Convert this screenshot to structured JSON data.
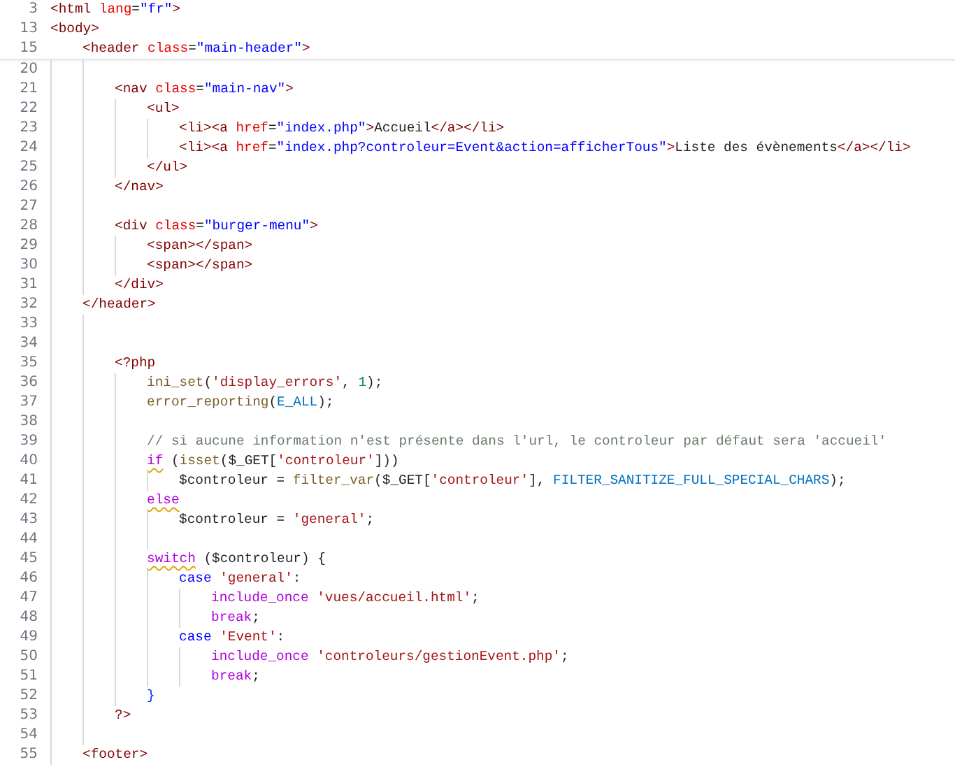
{
  "editor": {
    "sticky_lines": [
      {
        "number": "3",
        "tokens": [
          {
            "text": "<html",
            "kind": "tag"
          },
          {
            "text": " lang",
            "kind": "attr"
          },
          {
            "text": "=",
            "kind": "punct"
          },
          {
            "text": "\"fr\"",
            "kind": "astr"
          },
          {
            "text": ">",
            "kind": "tag"
          }
        ]
      },
      {
        "number": "13",
        "tokens": [
          {
            "text": "<body>",
            "kind": "tag"
          }
        ],
        "children": [
          {
            "number": "15",
            "tokens": [
              {
                "text": "<header",
                "kind": "tag"
              },
              {
                "text": " class",
                "kind": "attr"
              },
              {
                "text": "=",
                "kind": "punct"
              },
              {
                "text": "\"main-header\"",
                "kind": "astr"
              },
              {
                "text": ">",
                "kind": "tag"
              }
            ]
          }
        ]
      }
    ],
    "lines": [
      {
        "children": [
          {
            "number": "20"
          },
          {
            "number": "21",
            "tokens": [
              {
                "text": "<nav",
                "kind": "tag"
              },
              {
                "text": " class",
                "kind": "attr"
              },
              {
                "text": "=",
                "kind": "punct"
              },
              {
                "text": "\"main-nav\"",
                "kind": "astr"
              },
              {
                "text": ">",
                "kind": "tag"
              }
            ],
            "children": [
              {
                "number": "22",
                "tokens": [
                  {
                    "text": "<ul>",
                    "kind": "tag"
                  }
                ],
                "children": [
                  {
                    "number": "23",
                    "tokens": [
                      {
                        "text": "<li><a",
                        "kind": "tag"
                      },
                      {
                        "text": " href",
                        "kind": "attr"
                      },
                      {
                        "text": "=",
                        "kind": "punct"
                      },
                      {
                        "text": "\"index.php\"",
                        "kind": "astr"
                      },
                      {
                        "text": ">",
                        "kind": "tag"
                      },
                      {
                        "text": "Accueil",
                        "kind": "text"
                      },
                      {
                        "text": "</a></li>",
                        "kind": "tag"
                      }
                    ]
                  },
                  {
                    "number": "24",
                    "tokens": [
                      {
                        "text": "<li><a",
                        "kind": "tag"
                      },
                      {
                        "text": " href",
                        "kind": "attr"
                      },
                      {
                        "text": "=",
                        "kind": "punct"
                      },
                      {
                        "text": "\"index.php?controleur=Event&action=afficherTous\"",
                        "kind": "astr"
                      },
                      {
                        "text": ">",
                        "kind": "tag"
                      },
                      {
                        "text": "Liste des évènements",
                        "kind": "text"
                      },
                      {
                        "text": "</a></li>",
                        "kind": "tag"
                      }
                    ]
                  }
                ]
              },
              {
                "number": "25",
                "tokens": [
                  {
                    "text": "</ul>",
                    "kind": "tag"
                  }
                ]
              }
            ]
          },
          {
            "number": "26",
            "tokens": [
              {
                "text": "</nav>",
                "kind": "tag"
              }
            ]
          },
          {
            "number": "27"
          },
          {
            "number": "28",
            "tokens": [
              {
                "text": "<div",
                "kind": "tag"
              },
              {
                "text": " class",
                "kind": "attr"
              },
              {
                "text": "=",
                "kind": "punct"
              },
              {
                "text": "\"burger-menu\"",
                "kind": "astr"
              },
              {
                "text": ">",
                "kind": "tag"
              }
            ],
            "children": [
              {
                "number": "29",
                "tokens": [
                  {
                    "text": "<span></span>",
                    "kind": "tag"
                  }
                ]
              },
              {
                "number": "30",
                "tokens": [
                  {
                    "text": "<span></span>",
                    "kind": "tag"
                  }
                ]
              }
            ]
          },
          {
            "number": "31",
            "tokens": [
              {
                "text": "</div>",
                "kind": "tag"
              }
            ]
          }
        ]
      },
      {
        "number": "32",
        "tokens": [
          {
            "text": "</header>",
            "kind": "tag"
          }
        ]
      },
      {
        "children": [
          {
            "number": "33"
          },
          {
            "number": "34"
          },
          {
            "number": "35",
            "tokens": [
              {
                "text": "<?php",
                "kind": "php"
              }
            ],
            "children": [
              {
                "number": "36",
                "tokens": [
                  {
                    "text": "ini_set",
                    "kind": "fn"
                  },
                  {
                    "text": "(",
                    "kind": "punct"
                  },
                  {
                    "text": "'display_errors'",
                    "kind": "pstr"
                  },
                  {
                    "text": ", ",
                    "kind": "punct"
                  },
                  {
                    "text": "1",
                    "kind": "num"
                  },
                  {
                    "text": ");",
                    "kind": "punct"
                  }
                ]
              },
              {
                "number": "37",
                "tokens": [
                  {
                    "text": "error_reporting",
                    "kind": "fn"
                  },
                  {
                    "text": "(",
                    "kind": "punct"
                  },
                  {
                    "text": "E_ALL",
                    "kind": "const"
                  },
                  {
                    "text": ");",
                    "kind": "punct"
                  }
                ]
              },
              {
                "number": "38"
              },
              {
                "number": "39",
                "tokens": [
                  {
                    "text": "// si aucune information n'est présente dans l'url, le controleur par défaut sera 'accueil'",
                    "kind": "comment"
                  }
                ]
              },
              {
                "number": "40",
                "tokens": [
                  {
                    "text": "if",
                    "kind": "kw",
                    "warning": true
                  },
                  {
                    "text": " (",
                    "kind": "punct"
                  },
                  {
                    "text": "isset",
                    "kind": "fn"
                  },
                  {
                    "text": "(",
                    "kind": "punct"
                  },
                  {
                    "text": "$_GET",
                    "kind": "var"
                  },
                  {
                    "text": "[",
                    "kind": "punct"
                  },
                  {
                    "text": "'controleur'",
                    "kind": "pstr"
                  },
                  {
                    "text": "]))",
                    "kind": "punct"
                  }
                ],
                "children": [
                  {
                    "number": "41",
                    "tokens": [
                      {
                        "text": "$controleur",
                        "kind": "var"
                      },
                      {
                        "text": " = ",
                        "kind": "punct"
                      },
                      {
                        "text": "filter_var",
                        "kind": "fn"
                      },
                      {
                        "text": "(",
                        "kind": "punct"
                      },
                      {
                        "text": "$_GET",
                        "kind": "var"
                      },
                      {
                        "text": "[",
                        "kind": "punct"
                      },
                      {
                        "text": "'controleur'",
                        "kind": "pstr"
                      },
                      {
                        "text": "], ",
                        "kind": "punct"
                      },
                      {
                        "text": "FILTER_SANITIZE_FULL_SPECIAL_CHARS",
                        "kind": "const"
                      },
                      {
                        "text": ");",
                        "kind": "punct"
                      }
                    ]
                  }
                ]
              },
              {
                "number": "42",
                "tokens": [
                  {
                    "text": "else",
                    "kind": "kw",
                    "warning": true
                  }
                ],
                "children": [
                  {
                    "number": "43",
                    "tokens": [
                      {
                        "text": "$controleur",
                        "kind": "var"
                      },
                      {
                        "text": " = ",
                        "kind": "punct"
                      },
                      {
                        "text": "'general'",
                        "kind": "pstr"
                      },
                      {
                        "text": ";",
                        "kind": "punct"
                      }
                    ]
                  },
                  {
                    "number": "44"
                  }
                ]
              },
              {
                "number": "45",
                "tokens": [
                  {
                    "text": "switch",
                    "kind": "kw",
                    "warning": true
                  },
                  {
                    "text": " (",
                    "kind": "punct"
                  },
                  {
                    "text": "$controleur",
                    "kind": "var"
                  },
                  {
                    "text": ") {",
                    "kind": "punct"
                  }
                ],
                "children": [
                  {
                    "number": "46",
                    "tokens": [
                      {
                        "text": "case ",
                        "kind": "kw2"
                      },
                      {
                        "text": "'general'",
                        "kind": "pstr"
                      },
                      {
                        "text": ":",
                        "kind": "punct"
                      }
                    ],
                    "children": [
                      {
                        "number": "47",
                        "tokens": [
                          {
                            "text": "include_once ",
                            "kind": "kw"
                          },
                          {
                            "text": "'vues/accueil.html'",
                            "kind": "pstr"
                          },
                          {
                            "text": ";",
                            "kind": "punct"
                          }
                        ]
                      },
                      {
                        "number": "48",
                        "tokens": [
                          {
                            "text": "break",
                            "kind": "kw"
                          },
                          {
                            "text": ";",
                            "kind": "punct"
                          }
                        ]
                      }
                    ]
                  },
                  {
                    "number": "49",
                    "tokens": [
                      {
                        "text": "case ",
                        "kind": "kw2"
                      },
                      {
                        "text": "'Event'",
                        "kind": "pstr"
                      },
                      {
                        "text": ":",
                        "kind": "punct"
                      }
                    ],
                    "children": [
                      {
                        "number": "50",
                        "tokens": [
                          {
                            "text": "include_once ",
                            "kind": "kw"
                          },
                          {
                            "text": "'controleurs/gestionEvent.php'",
                            "kind": "pstr"
                          },
                          {
                            "text": ";",
                            "kind": "punct"
                          }
                        ]
                      },
                      {
                        "number": "51",
                        "tokens": [
                          {
                            "text": "break",
                            "kind": "kw"
                          },
                          {
                            "text": ";",
                            "kind": "punct"
                          }
                        ]
                      }
                    ]
                  }
                ]
              },
              {
                "number": "52",
                "tokens": [
                  {
                    "text": "}",
                    "kind": "bracket"
                  }
                ]
              }
            ]
          },
          {
            "number": "53",
            "tokens": [
              {
                "text": "?>",
                "kind": "php"
              }
            ]
          },
          {
            "number": "54"
          }
        ]
      },
      {
        "number": "55",
        "tokens": [
          {
            "text": "<footer>",
            "kind": "tag"
          }
        ]
      }
    ]
  }
}
